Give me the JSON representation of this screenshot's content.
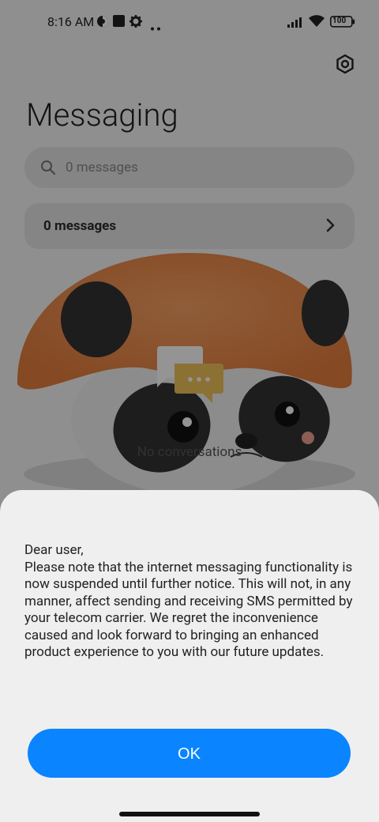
{
  "status_bar": {
    "time": "8:16 AM",
    "battery": "100",
    "icons": [
      "vpn-icon",
      "square-icon",
      "gear-icon",
      "more-dots-icon",
      "signal-icon",
      "wifi-icon",
      "battery-icon"
    ]
  },
  "app": {
    "title": "Messaging",
    "search_placeholder": "0 messages",
    "summary_label": "0 messages",
    "empty_state": "No conversations"
  },
  "dialog": {
    "message": "Dear user,\nPlease note that the internet messaging functionality is now suspended until further notice. This will not, in any manner, affect sending and receiving SMS permitted by your telecom carrier. We regret the inconvenience caused and look forward to bringing an enhanced product experience to you with our future updates.",
    "ok_label": "OK"
  },
  "colors": {
    "accent": "#0a84ff",
    "sheet_bg": "#efefef",
    "overlay": "rgba(0,0,0,0.42)"
  }
}
